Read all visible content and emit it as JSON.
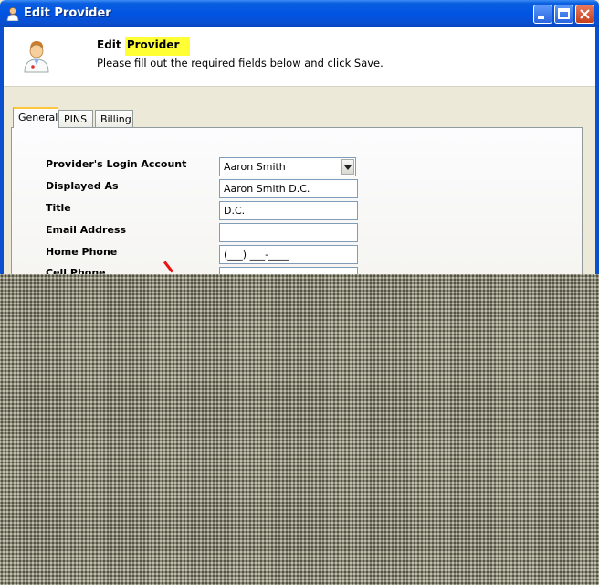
{
  "window": {
    "title": "Edit Provider"
  },
  "header": {
    "edit_word": "Edit",
    "highlight_word": "Provider",
    "instructions": "Please fill out the required fields below and click Save."
  },
  "tabs": [
    {
      "label": "General",
      "active": true
    },
    {
      "label": "PINS",
      "active": false
    },
    {
      "label": "Billing",
      "active": false
    }
  ],
  "form": {
    "login_account": {
      "label": "Provider's Login Account",
      "value": "Aaron Smith"
    },
    "displayed_as": {
      "label": "Displayed As",
      "value": "Aaron Smith D.C."
    },
    "title": {
      "label": "Title",
      "value": "D.C."
    },
    "email": {
      "label": "Email Address",
      "value": ""
    },
    "home_phone": {
      "label": "Home Phone",
      "value": "(___) ___-____"
    },
    "cell_phone": {
      "label": "Cell Phone",
      "value": ""
    }
  },
  "colors": {
    "highlight": "#ffff33",
    "titlebar": "#0054e3",
    "annotation": "#ee1111"
  }
}
